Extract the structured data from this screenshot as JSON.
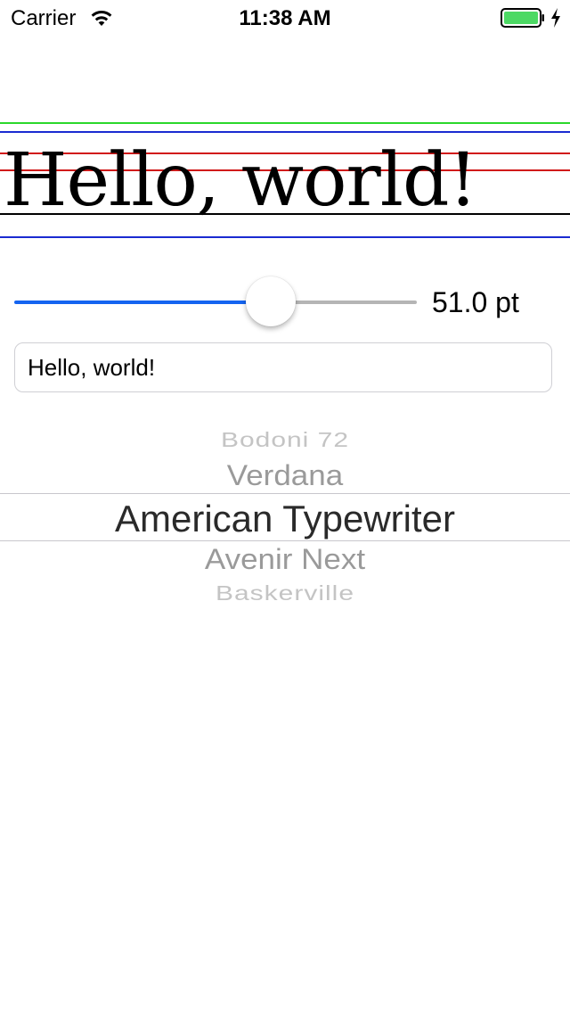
{
  "status_bar": {
    "carrier": "Carrier",
    "time": "11:38 AM",
    "battery_color": "#4cd964"
  },
  "preview": {
    "text": "Hello, world!",
    "metric_line_colors": {
      "ascender": "#2bd82b",
      "bounds": "#1a2bd1",
      "cap_height": "#d11a1a",
      "x_height": "#d11a1a",
      "baseline": "#000000"
    }
  },
  "font_size_slider": {
    "value": 51.0,
    "min": 0,
    "max": 80,
    "min_track_color": "#1464f0",
    "max_track_color": "#b5b5b5",
    "value_label": "51.0 pt"
  },
  "text_field": {
    "value": "Hello, world!"
  },
  "font_picker": {
    "items": [
      "Bodoni 72",
      "Verdana",
      "American Typewriter",
      "Avenir Next",
      "Baskerville"
    ],
    "selected": "American Typewriter"
  }
}
